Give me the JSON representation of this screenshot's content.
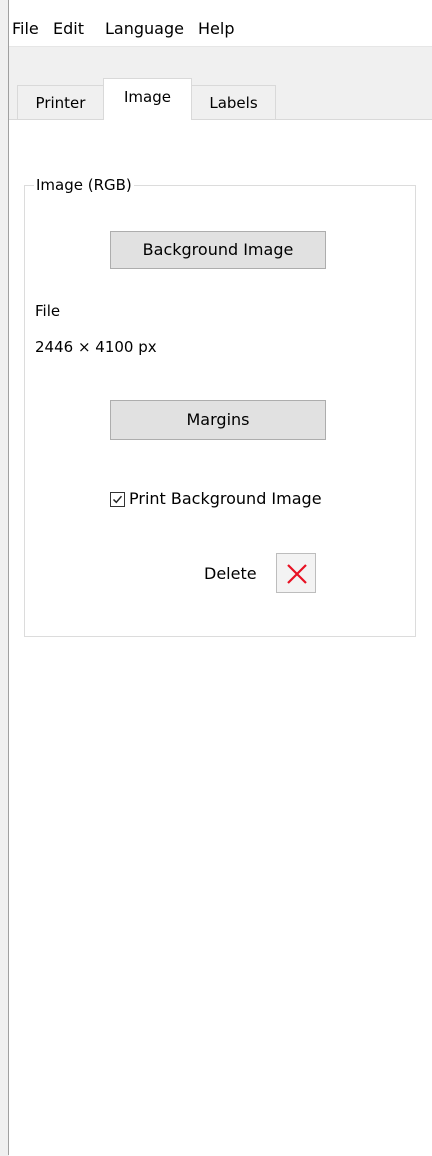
{
  "menu": {
    "file": "File",
    "edit": "Edit",
    "language": "Language",
    "help": "Help"
  },
  "tabs": [
    {
      "label": "Printer",
      "active": false
    },
    {
      "label": "Image",
      "active": true
    },
    {
      "label": "Labels",
      "active": false
    }
  ],
  "image_group": {
    "legend": "Image (RGB)",
    "background_button": "Background Image",
    "file_label": "File",
    "file_dimensions": "2446 × 4100 px",
    "margins_button": "Margins",
    "print_background": {
      "label": "Print Background Image",
      "checked": true
    },
    "delete_label": "Delete"
  },
  "icons": {
    "checkmark": "checkmark-icon",
    "delete": "red-x-icon"
  },
  "colors": {
    "delete_icon": "#e81123",
    "tab_panel_bg": "#ffffff",
    "window_bg": "#f0f0f0"
  }
}
